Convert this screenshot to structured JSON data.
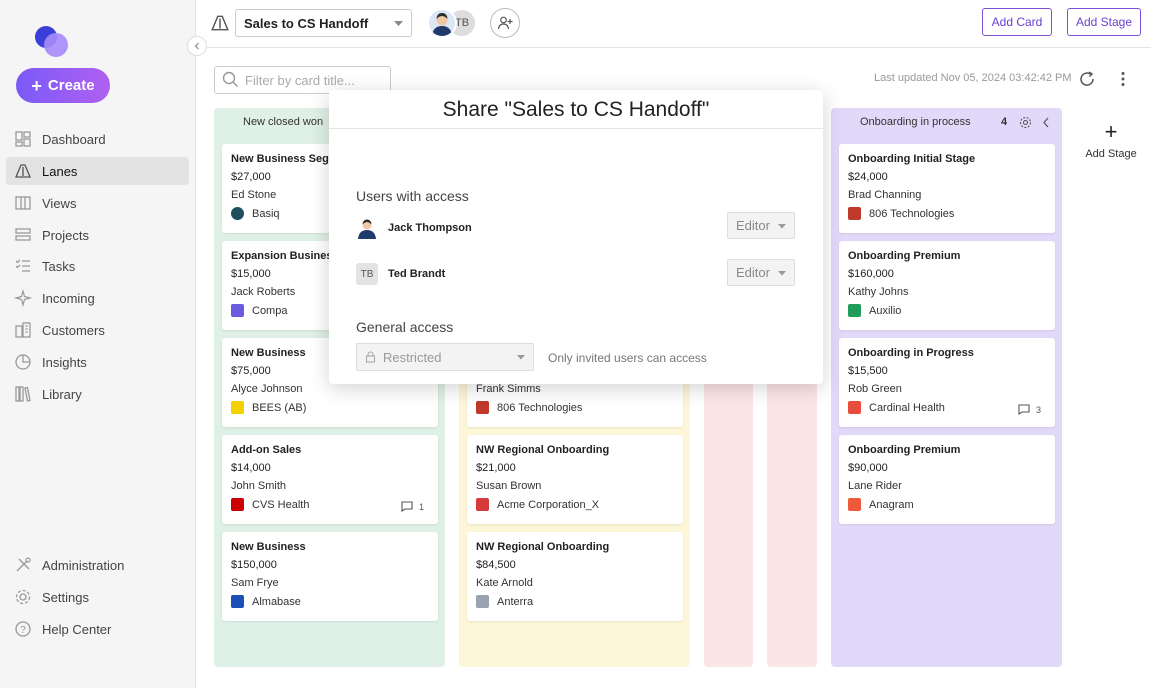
{
  "sidebar": {
    "create_label": "Create",
    "items": [
      {
        "label": "Dashboard",
        "icon": "dashboard-icon"
      },
      {
        "label": "Lanes",
        "icon": "lanes-icon",
        "active": true
      },
      {
        "label": "Views",
        "icon": "views-icon"
      },
      {
        "label": "Projects",
        "icon": "projects-icon"
      },
      {
        "label": "Tasks",
        "icon": "tasks-icon"
      },
      {
        "label": "Incoming",
        "icon": "incoming-icon"
      },
      {
        "label": "Customers",
        "icon": "customers-icon"
      },
      {
        "label": "Insights",
        "icon": "insights-icon"
      },
      {
        "label": "Library",
        "icon": "library-icon"
      }
    ],
    "bottom_items": [
      {
        "label": "Administration",
        "icon": "administration-icon"
      },
      {
        "label": "Settings",
        "icon": "settings-icon"
      },
      {
        "label": "Help Center",
        "icon": "help-icon"
      }
    ]
  },
  "topbar": {
    "board_name": "Sales to CS Handoff",
    "avatar_initials": "TB",
    "add_card_label": "Add Card",
    "add_stage_label": "Add Stage"
  },
  "toolbar": {
    "filter_placeholder": "Filter by card title...",
    "last_updated": "Last updated Nov 05, 2024 03:42:42 PM"
  },
  "lanes": [
    {
      "title": "New closed won",
      "color": "#dff0e6",
      "cards": [
        {
          "title": "New Business Segm",
          "value": "$27,000",
          "owner": "Ed Stone",
          "company": "Basiq",
          "logo_color": "#1f4e5f"
        },
        {
          "title": "Expansion Business",
          "value": "$15,000",
          "owner": "Jack Roberts",
          "company": "Compa",
          "logo_color": "#6b5be0"
        },
        {
          "title": "New Business",
          "value": "$75,000",
          "owner": "Alyce Johnson",
          "company": "BEES (AB)",
          "logo_color": "#f5d000"
        },
        {
          "title": "Add-on Sales",
          "value": "$14,000",
          "owner": "John Smith",
          "company": "CVS Health",
          "logo_color": "#cc0000",
          "comments": "1"
        },
        {
          "title": "New Business",
          "value": "$150,000",
          "owner": "Sam Frye",
          "company": "Almabase",
          "logo_color": "#1d4fb8"
        }
      ]
    },
    {
      "title": "",
      "color": "#fdf6d8",
      "cards": [
        {
          "title": "",
          "value": "",
          "owner": "Frank Simms",
          "company": "806 Technologies",
          "logo_color": "#c0392b"
        },
        {
          "title": "NW Regional Onboarding",
          "value": "$21,000",
          "owner": "Susan Brown",
          "company": "Acme Corporation_X",
          "logo_color": "#d63a3a"
        },
        {
          "title": "NW Regional Onboarding",
          "value": "$84,500",
          "owner": "Kate Arnold",
          "company": "Anterra",
          "logo_color": "#9aa4b0"
        }
      ]
    },
    {
      "title": "Onboarding in process",
      "count": "4",
      "color": "#e2d8f9",
      "cards": [
        {
          "title": "Onboarding Initial Stage",
          "value": "$24,000",
          "owner": "Brad Channing",
          "company": "806 Technologies",
          "logo_color": "#c0392b"
        },
        {
          "title": "Onboarding Premium",
          "value": "$160,000",
          "owner": "Kathy Johns",
          "company": "Auxilio",
          "logo_color": "#1e9e5a"
        },
        {
          "title": "Onboarding in Progress",
          "value": "$15,500",
          "owner": "Rob Green",
          "company": "Cardinal Health",
          "logo_color": "#e74c3c",
          "comments": "3"
        },
        {
          "title": "Onboarding Premium",
          "value": "$90,000",
          "owner": "Lane Rider",
          "company": "Anagram",
          "logo_color": "#f05a3c"
        }
      ]
    }
  ],
  "add_stage_col_label": "Add Stage",
  "share_modal": {
    "title": "Share \"Sales to CS Handoff\"",
    "users_label": "Users with access",
    "users": [
      {
        "name": "Jack Thompson",
        "role": "Editor"
      },
      {
        "name": "Ted Brandt",
        "initials": "TB",
        "role": "Editor"
      }
    ],
    "general_label": "General access",
    "general_value": "Restricted",
    "general_desc": "Only invited users can access"
  },
  "colors": {
    "accent": "#7a5af8",
    "button_border": "#7b4fd6"
  }
}
